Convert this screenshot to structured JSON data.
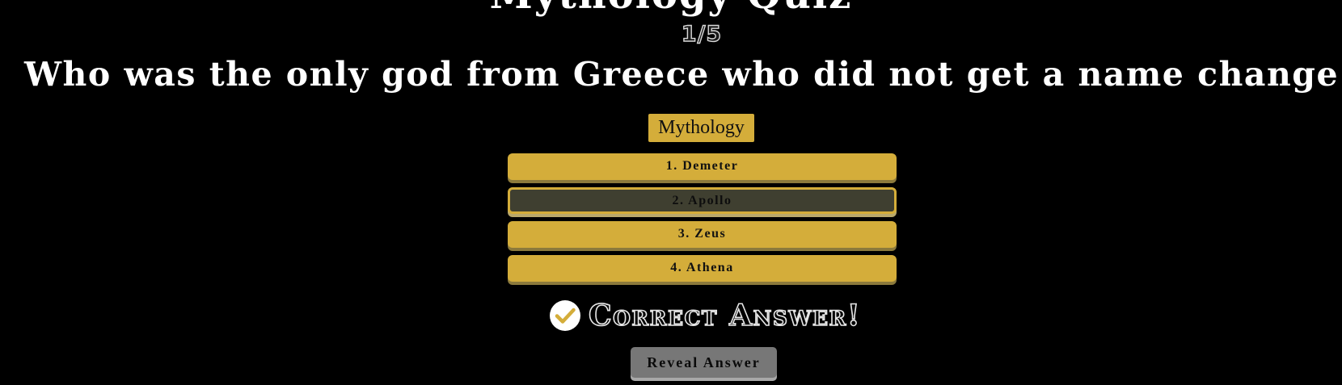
{
  "quiz": {
    "title": "Mythology Quiz",
    "progress": "1/5",
    "question": "Who was the only god from Greece who did not get a name change in Rome?",
    "category": "Mythology",
    "answers": [
      {
        "label": "1. Demeter",
        "state": "default"
      },
      {
        "label": "2. Apollo",
        "state": "selected"
      },
      {
        "label": "3. Zeus",
        "state": "default"
      },
      {
        "label": "4. Athena",
        "state": "default"
      }
    ],
    "result": {
      "icon": "check-circle-icon",
      "text": "Correct Answer!"
    },
    "reveal_label": "Reveal Answer"
  },
  "colors": {
    "background": "#000000",
    "accent_gold": "#d4ad3a",
    "selected_answer": "#3f3f30",
    "reveal_button": "#777777"
  }
}
